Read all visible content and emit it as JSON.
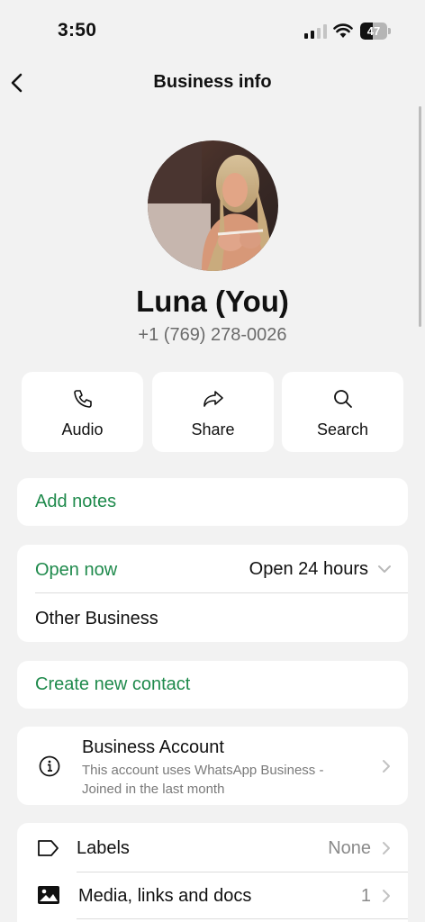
{
  "status_bar": {
    "time": "3:50",
    "battery": "47",
    "battery_level": 0.47
  },
  "nav": {
    "title": "Business info"
  },
  "profile": {
    "name": "Luna (You)",
    "phone": "+1 (769) 278-0026"
  },
  "actions": [
    {
      "label": "Audio",
      "icon": "phone-icon"
    },
    {
      "label": "Share",
      "icon": "share-icon"
    },
    {
      "label": "Search",
      "icon": "search-icon"
    }
  ],
  "notes": {
    "label": "Add notes"
  },
  "hours": {
    "status": "Open now",
    "value": "Open 24 hours",
    "category": "Other Business"
  },
  "contact": {
    "label": "Create new contact"
  },
  "account": {
    "title": "Business Account",
    "description": "This account uses WhatsApp Business - Joined in the last month"
  },
  "labels": {
    "label": "Labels",
    "value": "None"
  },
  "media": {
    "label": "Media, links and docs",
    "count": "1"
  },
  "colors": {
    "accent_green": "#1f8a4c",
    "background": "#f2f2f2"
  }
}
